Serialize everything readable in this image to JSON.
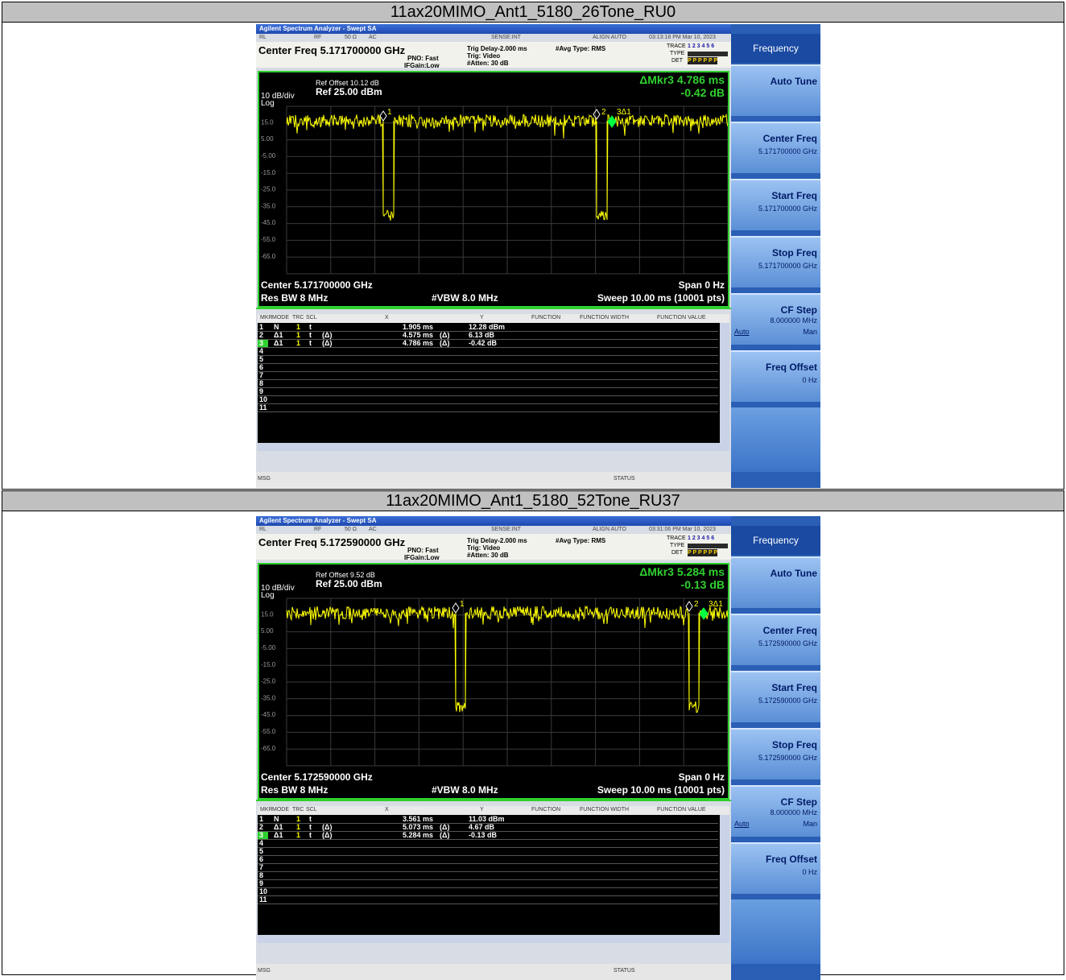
{
  "sections": [
    {
      "header": "11ax20MIMO_Ant1_5180_26Tone_RU0",
      "window_title": "Agilent Spectrum Analyzer - Swept SA",
      "status_items": {
        "rl": "RL",
        "rf": "RF",
        "ohm": "50 Ω",
        "ac": "AC",
        "sense": "SENSE:INT",
        "align": "ALIGN AUTO",
        "datetime": "03:13:18 PM Mar 10, 2023"
      },
      "center_freq_title": "Center Freq 5.171700000 GHz",
      "pno": "PNO: Fast",
      "ifgain": "IFGain:Low",
      "trig_delay": "Trig Delay-2.000 ms",
      "trig": "Trig: Video",
      "atten": "#Atten: 30 dB",
      "avg_type": "#Avg Type: RMS",
      "trace_label": "TRACE",
      "trace_nums": "1 2 3 4 5 6",
      "type_label": "TYPE",
      "det_label": "DET",
      "det_vals": "P P P P P P",
      "ref_offset": "Ref Offset 10.12 dB",
      "ref_level": "Ref 25.00 dBm",
      "scale": "10 dB/div",
      "log": "Log",
      "marker_readout": "ΔMkr3 4.786 ms",
      "marker_value": "-0.42 dB",
      "y_ticks": [
        "15.0",
        "5.00",
        "-5.00",
        "-15.0",
        "-25.0",
        "-35.0",
        "-45.0",
        "-55.0",
        "-65.0"
      ],
      "marker_labels": {
        "m1": "1",
        "m2": "2",
        "m3": "3Δ1"
      },
      "center_bottom": "Center 5.171700000 GHz",
      "span": "Span 0 Hz",
      "res_bw": "Res BW 8 MHz",
      "vbw": "#VBW 8.0 MHz",
      "sweep": "Sweep  10.00 ms (10001 pts)",
      "table_headers": [
        "MKR",
        "MODE",
        "TRC",
        "SCL",
        "X",
        "Y",
        "FUNCTION",
        "FUNCTION WIDTH",
        "FUNCTION VALUE"
      ],
      "table_rows": [
        {
          "mkr": "1",
          "mode": "N",
          "trc": "1",
          "scl": "t",
          "delta": "",
          "x": "1.905 ms",
          "xd": "",
          "y": "12.28 dBm"
        },
        {
          "mkr": "2",
          "mode": "Δ1",
          "trc": "1",
          "scl": "t",
          "delta": "(Δ)",
          "x": "4.575 ms",
          "xd": "(Δ)",
          "y": "6.13 dB"
        },
        {
          "mkr": "3",
          "mode": "Δ1",
          "trc": "1",
          "scl": "t",
          "delta": "(Δ)",
          "x": "4.786 ms",
          "xd": "(Δ)",
          "y": "-0.42 dB"
        },
        {
          "mkr": "4"
        },
        {
          "mkr": "5"
        },
        {
          "mkr": "6"
        },
        {
          "mkr": "7"
        },
        {
          "mkr": "8"
        },
        {
          "mkr": "9"
        },
        {
          "mkr": "10"
        },
        {
          "mkr": "11"
        }
      ],
      "msg": "MSG",
      "status": "STATUS",
      "softkeys": {
        "title": "Frequency",
        "auto_tune": "Auto Tune",
        "center_freq": "Center Freq",
        "center_freq_val": "5.171700000 GHz",
        "start_freq": "Start Freq",
        "start_freq_val": "5.171700000 GHz",
        "stop_freq": "Stop Freq",
        "stop_freq_val": "5.171700000 GHz",
        "cf_step": "CF Step",
        "cf_step_val": "8.000000 MHz",
        "cf_auto": "Auto",
        "cf_man": "Man",
        "freq_offset": "Freq Offset",
        "freq_offset_val": "0 Hz"
      }
    },
    {
      "header": "11ax20MIMO_Ant1_5180_52Tone_RU37",
      "window_title": "Agilent Spectrum Analyzer - Swept SA",
      "status_items": {
        "rl": "RL",
        "rf": "RF",
        "ohm": "50 Ω",
        "ac": "AC",
        "sense": "SENSE:INT",
        "align": "ALIGN AUTO",
        "datetime": "03:31:06 PM Mar 10, 2023"
      },
      "center_freq_title": "Center Freq 5.172590000 GHz",
      "pno": "PNO: Fast",
      "ifgain": "IFGain:Low",
      "trig_delay": "Trig Delay-2.000 ms",
      "trig": "Trig: Video",
      "atten": "#Atten: 30 dB",
      "avg_type": "#Avg Type: RMS",
      "trace_label": "TRACE",
      "trace_nums": "1 2 3 4 5 6",
      "type_label": "TYPE",
      "det_label": "DET",
      "det_vals": "P P P P P P",
      "ref_offset": "Ref Offset 9.52 dB",
      "ref_level": "Ref 25.00 dBm",
      "scale": "10 dB/div",
      "log": "Log",
      "marker_readout": "ΔMkr3 5.284 ms",
      "marker_value": "-0.13 dB",
      "y_ticks": [
        "15.0",
        "5.00",
        "-5.00",
        "-15.0",
        "-25.0",
        "-35.0",
        "-45.0",
        "-55.0",
        "-65.0"
      ],
      "marker_labels": {
        "m1": "1",
        "m2": "2",
        "m3": "3Δ1"
      },
      "center_bottom": "Center 5.172590000 GHz",
      "span": "Span 0 Hz",
      "res_bw": "Res BW 8 MHz",
      "vbw": "#VBW 8.0 MHz",
      "sweep": "Sweep  10.00 ms (10001 pts)",
      "table_headers": [
        "MKR",
        "MODE",
        "TRC",
        "SCL",
        "X",
        "Y",
        "FUNCTION",
        "FUNCTION WIDTH",
        "FUNCTION VALUE"
      ],
      "table_rows": [
        {
          "mkr": "1",
          "mode": "N",
          "trc": "1",
          "scl": "t",
          "delta": "",
          "x": "3.561 ms",
          "xd": "",
          "y": "11.03 dBm"
        },
        {
          "mkr": "2",
          "mode": "Δ1",
          "trc": "1",
          "scl": "t",
          "delta": "(Δ)",
          "x": "5.073 ms",
          "xd": "(Δ)",
          "y": "4.67 dB"
        },
        {
          "mkr": "3",
          "mode": "Δ1",
          "trc": "1",
          "scl": "t",
          "delta": "(Δ)",
          "x": "5.284 ms",
          "xd": "(Δ)",
          "y": "-0.13 dB"
        },
        {
          "mkr": "4"
        },
        {
          "mkr": "5"
        },
        {
          "mkr": "6"
        },
        {
          "mkr": "7"
        },
        {
          "mkr": "8"
        },
        {
          "mkr": "9"
        },
        {
          "mkr": "10"
        },
        {
          "mkr": "11"
        }
      ],
      "msg": "MSG",
      "status": "STATUS",
      "softkeys": {
        "title": "Frequency",
        "auto_tune": "Auto Tune",
        "center_freq": "Center Freq",
        "center_freq_val": "5.172590000 GHz",
        "start_freq": "Start Freq",
        "start_freq_val": "5.172590000 GHz",
        "stop_freq": "Stop Freq",
        "stop_freq_val": "5.172590000 GHz",
        "cf_step": "CF Step",
        "cf_step_val": "8.000000 MHz",
        "cf_auto": "Auto",
        "cf_man": "Man",
        "freq_offset": "Freq Offset",
        "freq_offset_val": "0 Hz"
      }
    }
  ],
  "colors": {
    "trace": "#ffff00",
    "marker": "#00ff40",
    "frame": "#2fd02f",
    "softkey_title": "#1a4aa2"
  }
}
